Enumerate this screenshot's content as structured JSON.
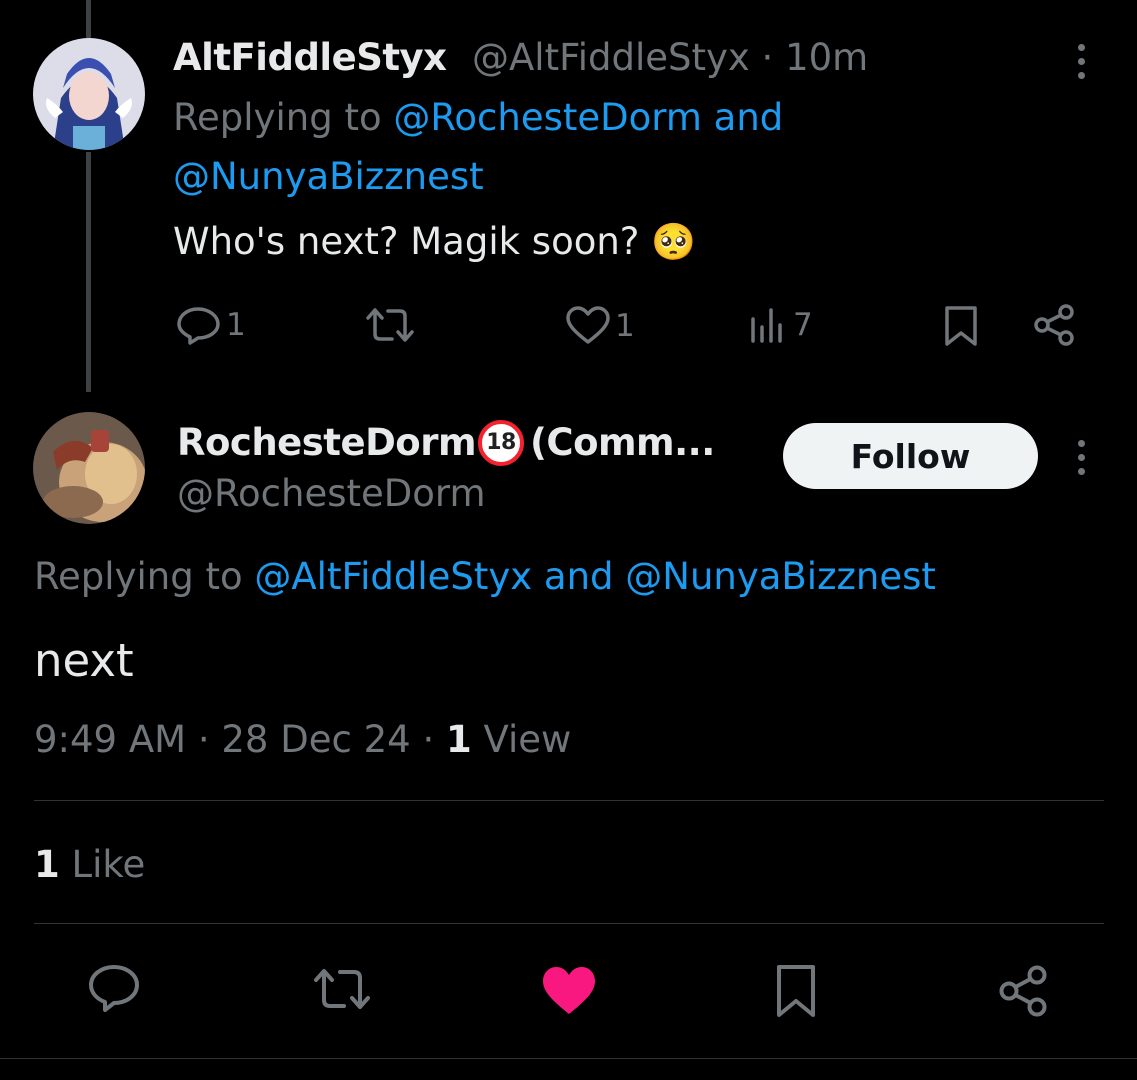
{
  "reply_tweet": {
    "display_name": "AltFiddleStyx",
    "handle": "@AltFiddleStyx",
    "separator": "·",
    "time_ago": "10m",
    "replying_to_prefix": "Replying to",
    "replying_to_line1": "@RochesteDorm and",
    "replying_to_line2": "@NunyaBizznest",
    "text": "Who's next? Magik soon?",
    "emoji": "🥺",
    "actions": {
      "reply_count": "1",
      "repost_count": "",
      "like_count": "1",
      "views_count": "7"
    }
  },
  "main_tweet": {
    "display_name": "RochesteDorm",
    "name_suffix": "(Comm...",
    "badge_18": "18",
    "handle": "@RochesteDorm",
    "follow_label": "Follow",
    "replying_to_prefix": "Replying to",
    "replying_to_targets": "@AltFiddleStyx and @NunyaBizznest",
    "text": "next",
    "timestamp": "9:49 AM",
    "date": "28 Dec 24",
    "separator": "·",
    "view_count": "1",
    "view_label": "View",
    "like_count": "1",
    "like_label": "Like"
  },
  "colors": {
    "background": "#000000",
    "text": "#e7e9ea",
    "muted": "#71767b",
    "link": "#1d9bf0",
    "liked_heart": "#f91880",
    "divider": "#2f3336"
  },
  "icons": [
    "reply-icon",
    "repost-icon",
    "like-icon",
    "views-icon",
    "bookmark-icon",
    "share-icon",
    "more-icon",
    "liked-heart-icon"
  ]
}
